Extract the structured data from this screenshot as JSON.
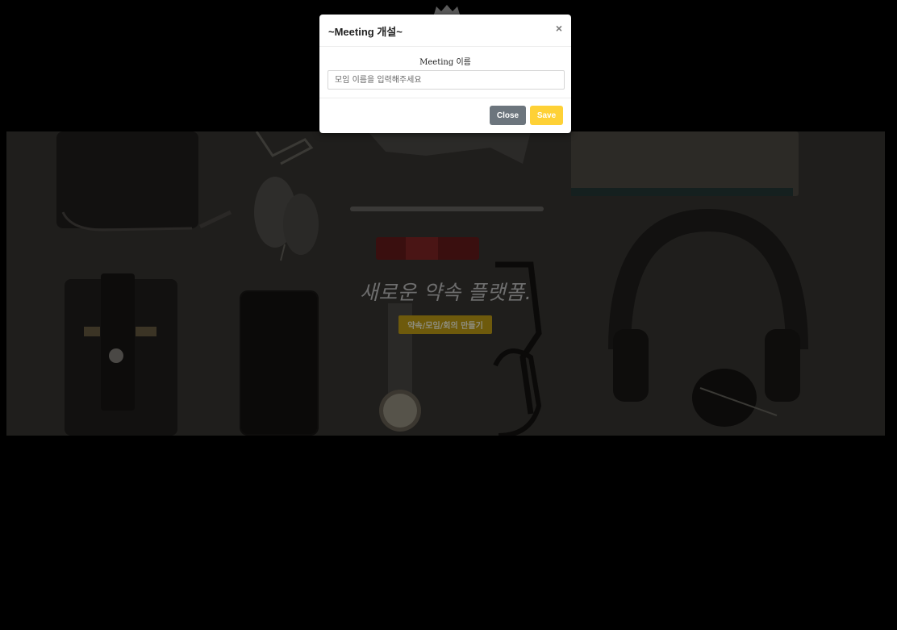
{
  "brand": {
    "logo_icon": "crown-icon"
  },
  "hero": {
    "tagline": "새로운 약속 플랫폼.",
    "cta_label": "약속/모임/회의 만들기",
    "cta_color": "#6e5a0c"
  },
  "modal": {
    "title": "~Meeting 개설~",
    "close_icon": "×",
    "field_label": "Meeting 이름",
    "field_value": "",
    "field_placeholder": "모임 이름을 입력해주세요",
    "close_label": "Close",
    "save_label": "Save",
    "close_color": "#6c757d",
    "save_color": "#fed136"
  }
}
